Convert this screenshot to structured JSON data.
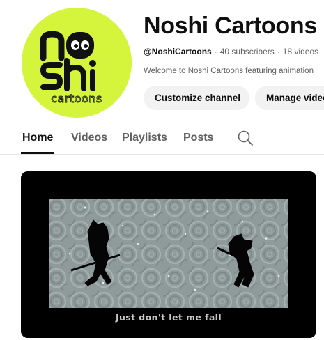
{
  "channel": {
    "name": "Noshi Cartoons",
    "handle": "@NoshiCartoons",
    "subscribers": "40 subscribers",
    "videos": "18 videos",
    "description": "Welcome to Noshi Cartoons featuring animation",
    "avatar_text": [
      "no",
      "shi",
      "cartoons"
    ],
    "avatar_color": "#d4f53c"
  },
  "buttons": {
    "customize": "Customize channel",
    "manage": "Manage videos"
  },
  "tabs": [
    {
      "label": "Home",
      "active": true
    },
    {
      "label": "Videos",
      "active": false
    },
    {
      "label": "Playlists",
      "active": false
    },
    {
      "label": "Posts",
      "active": false
    }
  ],
  "search_icon": "search-icon",
  "video": {
    "subtitle": "Just don't let me fall"
  }
}
